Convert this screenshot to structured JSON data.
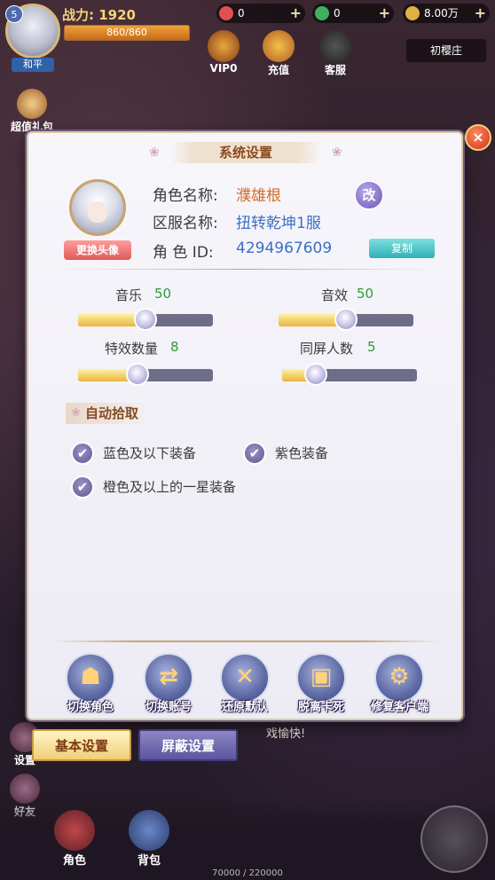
{
  "hud": {
    "level": "5",
    "status_badge": "和平",
    "power_label": "战力:",
    "power_value": "1920",
    "hp_text": "860/860",
    "hp_fraction": 1.0,
    "resources": [
      {
        "name": "gem-red",
        "value": "0",
        "color": "#e05050"
      },
      {
        "name": "gem-green",
        "value": "0",
        "color": "#40b060"
      },
      {
        "name": "coin",
        "value": "8.00万",
        "color": "#e0b040"
      }
    ],
    "top_icons": [
      {
        "name": "vip",
        "label": "VIP0"
      },
      {
        "name": "recharge",
        "label": "充值"
      },
      {
        "name": "service",
        "label": "客服"
      }
    ],
    "map_name": "初樱庄",
    "left_buttons": [
      {
        "name": "gift",
        "label": "超值礼包"
      },
      {
        "name": "settings",
        "label": "设置"
      },
      {
        "name": "friends",
        "label": "好友"
      }
    ],
    "bottom_icons": [
      {
        "name": "character",
        "label": "角色"
      },
      {
        "name": "bag",
        "label": "背包"
      }
    ],
    "exp_text": "70000 / 220000",
    "chat_text": "戏愉快!"
  },
  "dialog": {
    "title": "系统设置",
    "close_label": "×",
    "change_avatar_label": "更换头像",
    "info": [
      {
        "label": "角色名称:",
        "value": "濮雄根",
        "tone": "orange"
      },
      {
        "label": "区服名称:",
        "value": "扭转乾坤1服",
        "tone": "blue"
      },
      {
        "label": "角 色 ID:",
        "value": "4294967609",
        "tone": "blue"
      }
    ],
    "rename_label": "改",
    "copy_label": "复制",
    "sliders": [
      {
        "label": "音乐",
        "value": "50",
        "fraction": 0.5
      },
      {
        "label": "音效",
        "value": "50",
        "fraction": 0.5
      },
      {
        "label": "特效数量",
        "value": "8",
        "fraction": 0.44
      },
      {
        "label": "同屏人数",
        "value": "5",
        "fraction": 0.25
      }
    ],
    "auto_pick_title": "自动拾取",
    "checkboxes": [
      {
        "label": "蓝色及以下装备",
        "checked": true
      },
      {
        "label": "紫色装备",
        "checked": true
      },
      {
        "label": "橙色及以上的一星装备",
        "checked": true
      }
    ],
    "actions": [
      {
        "label": "切换角色",
        "icon": "helmet-icon",
        "glyph": "☗"
      },
      {
        "label": "切换账号",
        "icon": "switch-icon",
        "glyph": "⇄"
      },
      {
        "label": "还原默认",
        "icon": "tools-icon",
        "glyph": "✕"
      },
      {
        "label": "脱离卡死",
        "icon": "monitor-icon",
        "glyph": "▣"
      },
      {
        "label": "修复客户端",
        "icon": "repair-icon",
        "glyph": "⚙"
      }
    ]
  },
  "tabs": {
    "basic": "基本设置",
    "shield": "屏蔽设置"
  }
}
